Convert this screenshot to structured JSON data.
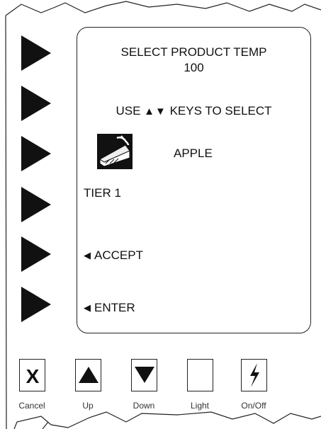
{
  "display": {
    "title": "SELECT PRODUCT TEMP",
    "temperature": "100",
    "instruction_prefix": "USE",
    "instruction_arrows": "▲▼",
    "instruction_suffix": "KEYS TO SELECT",
    "product_name": "APPLE",
    "tier": "TIER 1",
    "accept_label": "ACCEPT",
    "enter_label": "ENTER",
    "soft_key_arrow": "◀"
  },
  "side_keys": [
    "right-triangle-icon",
    "right-triangle-icon",
    "right-triangle-icon",
    "right-triangle-icon",
    "right-triangle-icon",
    "right-triangle-icon"
  ],
  "bottom_keys": {
    "cancel": {
      "label": "Cancel",
      "icon": "x-icon"
    },
    "up": {
      "label": "Up",
      "icon": "up-triangle-icon"
    },
    "down": {
      "label": "Down",
      "icon": "down-triangle-icon"
    },
    "light": {
      "label": "Light",
      "icon": ""
    },
    "power": {
      "label": "On/Off",
      "icon": "lightning-bolt-icon"
    }
  },
  "colors": {
    "ink": "#111111",
    "background": "#ffffff"
  }
}
